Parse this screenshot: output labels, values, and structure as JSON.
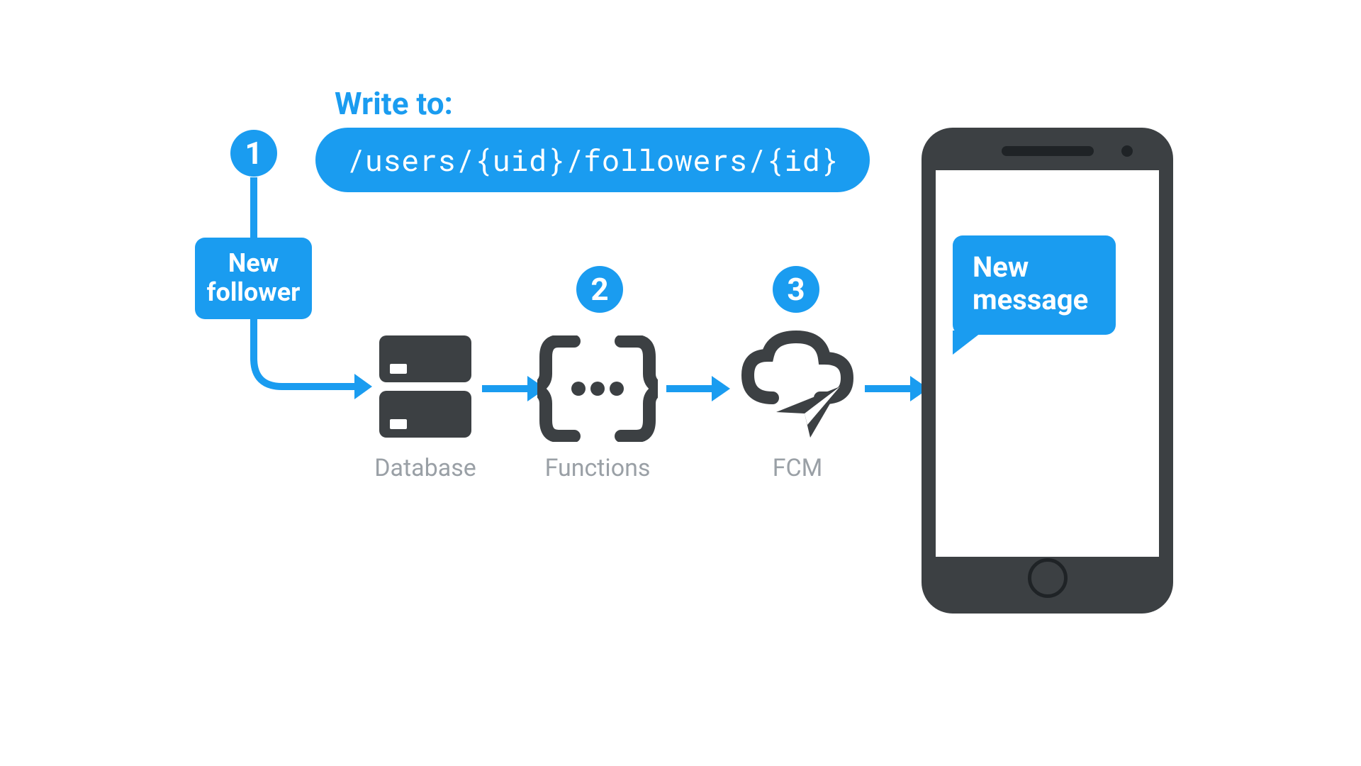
{
  "header": {
    "write_label": "Write to:",
    "path": "/users/{uid}/followers/{id}"
  },
  "steps": {
    "s1": "1",
    "s2": "2",
    "s3": "3"
  },
  "trigger_box": "New follower",
  "nodes": {
    "database": "Database",
    "functions": "Functions",
    "fcm": "FCM"
  },
  "phone": {
    "bubble_text": "New message"
  },
  "colors": {
    "accent": "#1a9cf0",
    "icon_dark": "#3c4043",
    "label_gray": "#9aa0a6"
  }
}
